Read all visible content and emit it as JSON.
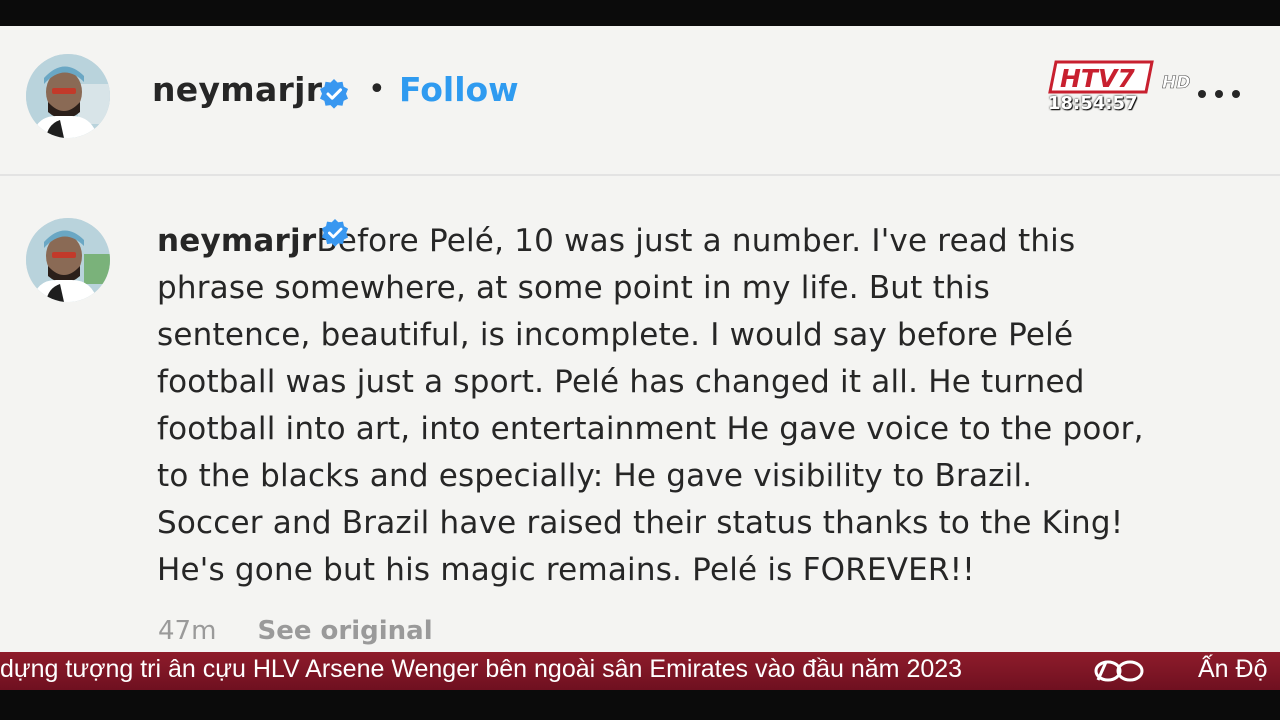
{
  "post_header": {
    "username": "neymarjr",
    "separator": "•",
    "follow_label": "Follow"
  },
  "comment": {
    "username": "neymarjr",
    "lines": [
      "Before Pelé, 10 was just a number. I've read this",
      "phrase somewhere, at some point in my life. But this",
      "sentence, beautiful, is incomplete. I would say before Pelé",
      "football was just a sport. Pelé has changed it all. He turned",
      "football into art, into entertainment He gave voice to the poor,",
      "to the blacks and especially: He gave visibility to Brazil.",
      "Soccer and Brazil have raised their status thanks to the King!",
      "He's gone but his magic remains. Pelé is FOREVER!!"
    ],
    "time": "47m",
    "see_original_label": "See original"
  },
  "broadcast": {
    "channel_logo_text": "HTV7",
    "channel_logo_hd": "HD",
    "clock": "18:54:57",
    "ticker_text": "dựng tượng tri ân cựu HLV Arsene Wenger bên ngoài sân Emirates vào đầu năm 2023",
    "ticker_next": "Ấn Độ"
  },
  "colors": {
    "follow_blue": "#2f9bf0",
    "verified_blue": "#3897f0",
    "ticker_red": "#8e1c2b",
    "panel_bg": "#f4f4f2"
  },
  "icons": {
    "verified": "verified-badge-icon",
    "more": "more-options-icon",
    "avatar": "profile-avatar"
  }
}
